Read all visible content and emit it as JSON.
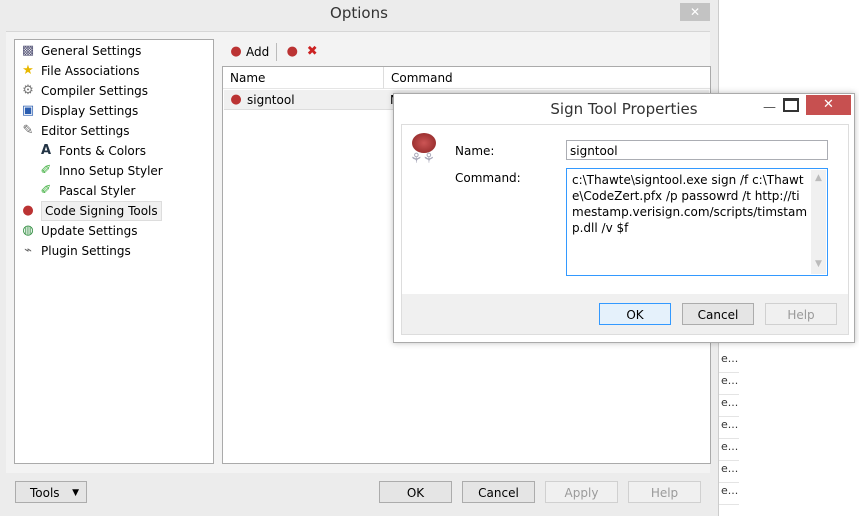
{
  "options": {
    "title": "Options",
    "tree": [
      {
        "label": "General Settings",
        "icon": "general-settings-icon"
      },
      {
        "label": "File Associations",
        "icon": "star-icon"
      },
      {
        "label": "Compiler Settings",
        "icon": "gear-icon"
      },
      {
        "label": "Display Settings",
        "icon": "monitor-icon"
      },
      {
        "label": "Editor Settings",
        "icon": "editor-icon"
      },
      {
        "label": "Fonts & Colors",
        "icon": "font-icon"
      },
      {
        "label": "Inno Setup Styler",
        "icon": "highlighter-icon"
      },
      {
        "label": "Pascal Styler",
        "icon": "highlighter-icon"
      },
      {
        "label": "Code Signing Tools",
        "icon": "seal-icon"
      },
      {
        "label": "Update Settings",
        "icon": "globe-icon"
      },
      {
        "label": "Plugin Settings",
        "icon": "plug-icon"
      }
    ],
    "toolbar": {
      "add": "Add"
    },
    "columns": [
      "Name",
      "Command"
    ],
    "rows": [
      {
        "name": "signtool",
        "command": "N"
      }
    ],
    "buttons": {
      "tools": "Tools",
      "ok": "OK",
      "cancel": "Cancel",
      "apply": "Apply",
      "help": "Help"
    }
  },
  "dialog": {
    "title": "Sign Tool Properties",
    "name_label": "Name:",
    "command_label": "Command:",
    "name_value": "signtool",
    "command_value": "c:\\Thawte\\signtool.exe sign /f c:\\Thawte\\CodeZert.pfx /p passowrd /t http://timestamp.verisign.com/scripts/timstamp.dll /v $f",
    "ok": "OK",
    "cancel": "Cancel",
    "help": "Help"
  },
  "background": {
    "fragments": [
      "e...",
      "e...",
      "e...",
      "e...",
      "e...",
      "e...",
      "e..."
    ]
  },
  "colors": {
    "close_red": "#c75050",
    "focus_blue": "#3399ff"
  }
}
